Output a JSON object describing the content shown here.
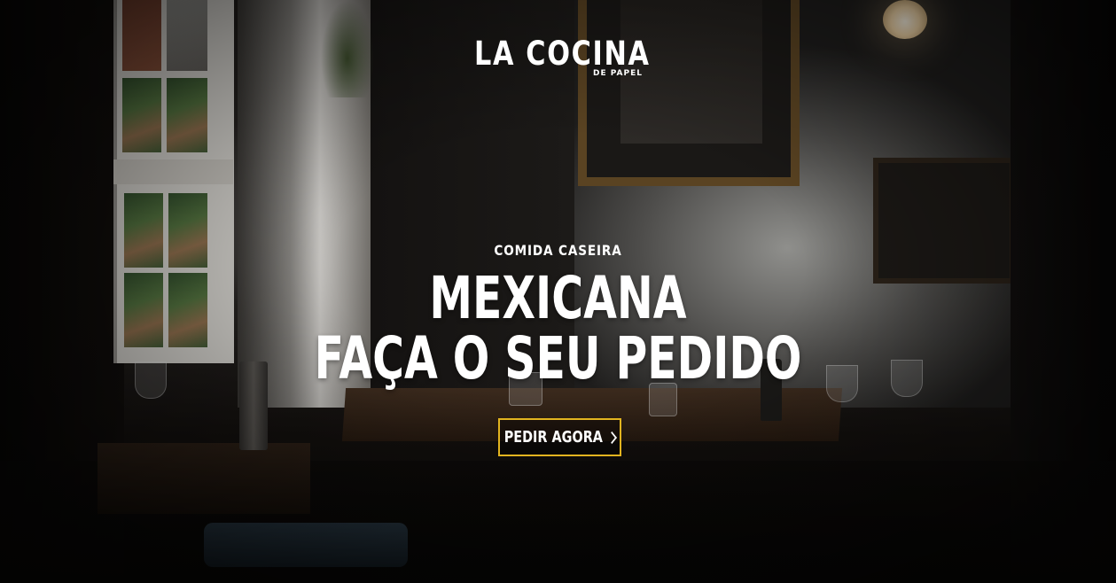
{
  "brand": {
    "name": "LA COCINA",
    "subtitle": "DE PAPEL"
  },
  "hero": {
    "eyebrow": "COMIDA CASEIRA",
    "headline_line1": "MEXICANA",
    "headline_line2": "FAÇA O SEU PEDIDO",
    "cta_label": "PEDIR AGORA",
    "cta_icon": "chevron-right-icon",
    "background_image": "dark-restaurant-interior-photo"
  },
  "colors": {
    "cta_border": "#e2b41f",
    "text": "#ffffff"
  }
}
